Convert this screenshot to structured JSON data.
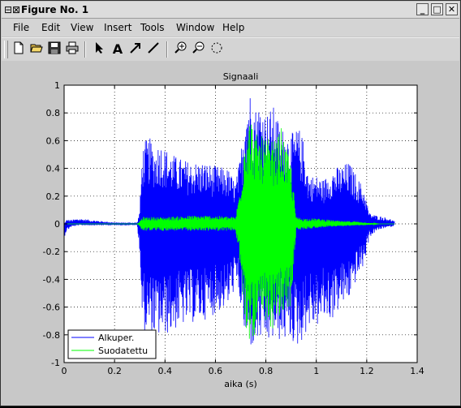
{
  "window": {
    "title": "Figure No. 1",
    "buttons": [
      "_",
      "□",
      "✕"
    ]
  },
  "menu": [
    "File",
    "Edit",
    "View",
    "Insert",
    "Tools",
    "Window",
    "Help"
  ],
  "toolbar": {
    "icons": [
      "new-file-icon",
      "open-folder-icon",
      "save-icon",
      "print-icon",
      "select-arrow-icon",
      "insert-text-icon",
      "insert-arrow-icon",
      "insert-line-icon",
      "zoom-in-icon",
      "zoom-out-icon",
      "rotate-icon"
    ]
  },
  "chart_data": {
    "type": "line",
    "title": "Signaali",
    "xlabel": "aika (s)",
    "ylabel": "",
    "xlim": [
      0,
      1.4
    ],
    "ylim": [
      -1,
      1
    ],
    "xticks": [
      "0",
      "0.2",
      "0.4",
      "0.6",
      "0.8",
      "1",
      "1.2",
      "1.4"
    ],
    "yticks": [
      "-1",
      "-0.8",
      "-0.6",
      "-0.4",
      "-0.2",
      "0",
      "0.2",
      "0.4",
      "0.6",
      "0.8",
      "1"
    ],
    "grid": true,
    "legend_position": "lower-left",
    "series": [
      {
        "name": "Alkuper.",
        "color": "#0000ff",
        "envelope": {
          "x": [
            0,
            0.01,
            0.03,
            0.06,
            0.1,
            0.15,
            0.2,
            0.25,
            0.29,
            0.3,
            0.31,
            0.32,
            0.34,
            0.36,
            0.38,
            0.4,
            0.42,
            0.45,
            0.5,
            0.55,
            0.6,
            0.65,
            0.68,
            0.7,
            0.72,
            0.74,
            0.76,
            0.78,
            0.8,
            0.83,
            0.86,
            0.9,
            0.93,
            0.95,
            0.97,
            1.0,
            1.03,
            1.06,
            1.1,
            1.13,
            1.16,
            1.19,
            1.21,
            1.24,
            1.27,
            1.3,
            1.31
          ],
          "upper": [
            0.0,
            0.03,
            0.03,
            0.04,
            0.03,
            0.02,
            0.01,
            0.01,
            0.01,
            0.1,
            0.55,
            0.6,
            0.62,
            0.55,
            0.6,
            0.55,
            0.52,
            0.48,
            0.45,
            0.45,
            0.42,
            0.4,
            0.3,
            0.5,
            0.95,
            0.97,
            0.85,
            0.9,
            0.8,
            0.85,
            0.7,
            0.65,
            0.7,
            0.6,
            0.35,
            0.35,
            0.32,
            0.4,
            0.42,
            0.45,
            0.35,
            0.25,
            0.08,
            0.06,
            0.05,
            0.03,
            0.02
          ],
          "lower": [
            -0.1,
            -0.05,
            -0.02,
            -0.01,
            -0.01,
            -0.01,
            -0.01,
            -0.01,
            -0.01,
            -0.2,
            -0.75,
            -0.8,
            -0.8,
            -0.82,
            -0.82,
            -0.8,
            -0.8,
            -0.75,
            -0.72,
            -0.7,
            -0.65,
            -0.6,
            -0.45,
            -0.6,
            -0.88,
            -0.9,
            -0.9,
            -0.85,
            -0.88,
            -0.85,
            -0.85,
            -0.85,
            -0.9,
            -0.82,
            -0.75,
            -0.75,
            -0.7,
            -0.7,
            -0.6,
            -0.55,
            -0.4,
            -0.3,
            -0.1,
            -0.05,
            -0.03,
            -0.02,
            -0.01
          ]
        }
      },
      {
        "name": "Suodatettu",
        "color": "#00ff00",
        "envelope": {
          "x": [
            0,
            0.1,
            0.2,
            0.29,
            0.3,
            0.31,
            0.4,
            0.5,
            0.6,
            0.68,
            0.7,
            0.72,
            0.74,
            0.76,
            0.8,
            0.84,
            0.86,
            0.88,
            0.9,
            0.92,
            0.95,
            1.0,
            1.05,
            1.1,
            1.15,
            1.2,
            1.25,
            1.31
          ],
          "upper": [
            0.0,
            0.0,
            0.0,
            0.0,
            0.02,
            0.05,
            0.05,
            0.06,
            0.06,
            0.05,
            0.3,
            0.75,
            0.78,
            0.65,
            0.62,
            0.6,
            0.7,
            0.55,
            0.45,
            0.05,
            0.04,
            0.04,
            0.03,
            0.02,
            0.02,
            0.01,
            0.0,
            0.0
          ],
          "lower": [
            0.0,
            0.0,
            0.0,
            0.0,
            -0.02,
            -0.05,
            -0.05,
            -0.05,
            -0.05,
            -0.05,
            -0.35,
            -0.8,
            -0.85,
            -0.8,
            -0.78,
            -0.75,
            -0.7,
            -0.65,
            -0.6,
            -0.05,
            -0.04,
            -0.03,
            -0.02,
            -0.02,
            -0.01,
            -0.01,
            0.0,
            0.0
          ]
        }
      }
    ]
  }
}
